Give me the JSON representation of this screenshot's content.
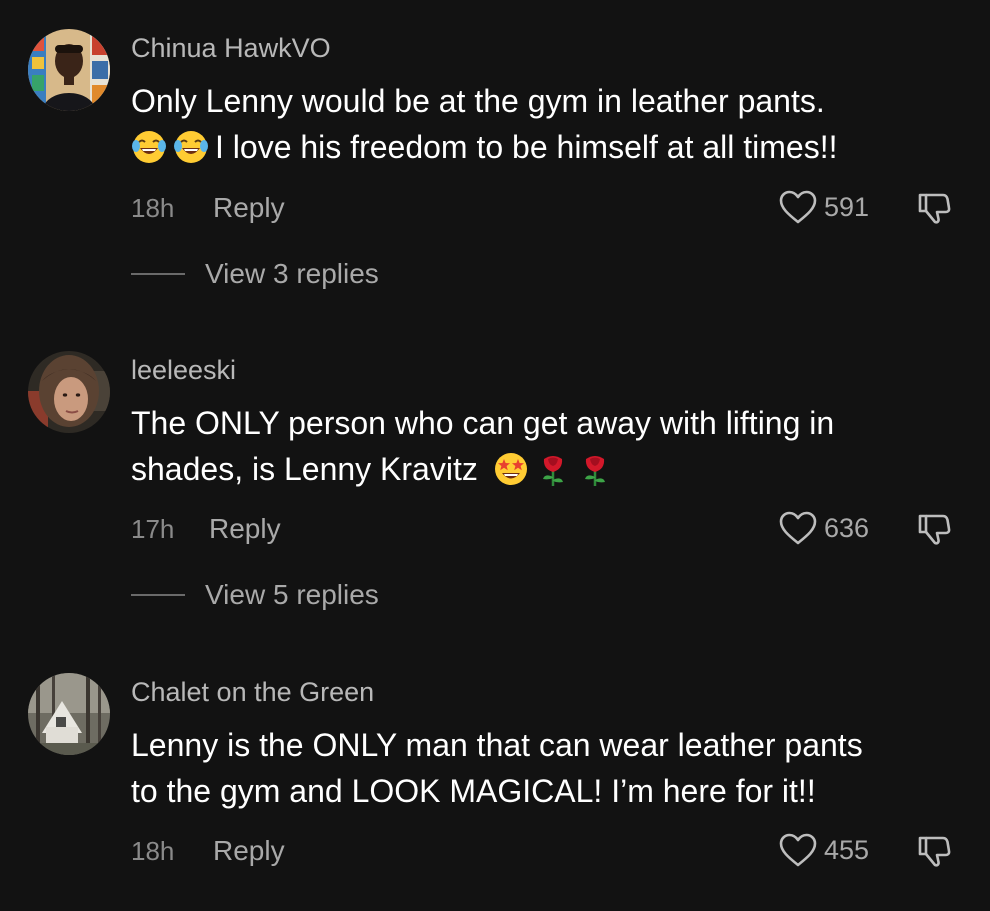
{
  "comments": [
    {
      "username": "Chinua HawkVO",
      "text_line1": "Only Lenny would be at the gym in leather pants.",
      "text_line2": "I love his freedom to be himself at all times!!",
      "time": "18h",
      "reply_label": "Reply",
      "likes": "591",
      "view_replies": "View 3 replies",
      "avatar_icon": "avatar-photo"
    },
    {
      "username": "leeleeski",
      "text_line1": "The ONLY person who can get away with lifting in",
      "text_line2": "shades, is Lenny Kravitz",
      "time": "17h",
      "reply_label": "Reply",
      "likes": "636",
      "view_replies": "View 5 replies",
      "avatar_icon": "avatar-photo"
    },
    {
      "username": "Chalet on the Green",
      "text_line1": "Lenny is the ONLY man that can wear leather pants",
      "text_line2": "to the gym and LOOK MAGICAL! I’m here for it!!",
      "time": "18h",
      "reply_label": "Reply",
      "likes": "455",
      "avatar_icon": "avatar-photo"
    }
  ],
  "icons": {
    "like": "heart-outline-icon",
    "dislike": "thumbs-down-icon",
    "emoji_laugh": "face-with-tears-of-joy-emoji",
    "emoji_star": "star-struck-emoji",
    "emoji_rose": "rose-emoji"
  },
  "colors": {
    "background": "#121212",
    "text_primary": "#ffffff",
    "text_secondary": "#a9a9a9",
    "username": "#b8b8b8"
  }
}
